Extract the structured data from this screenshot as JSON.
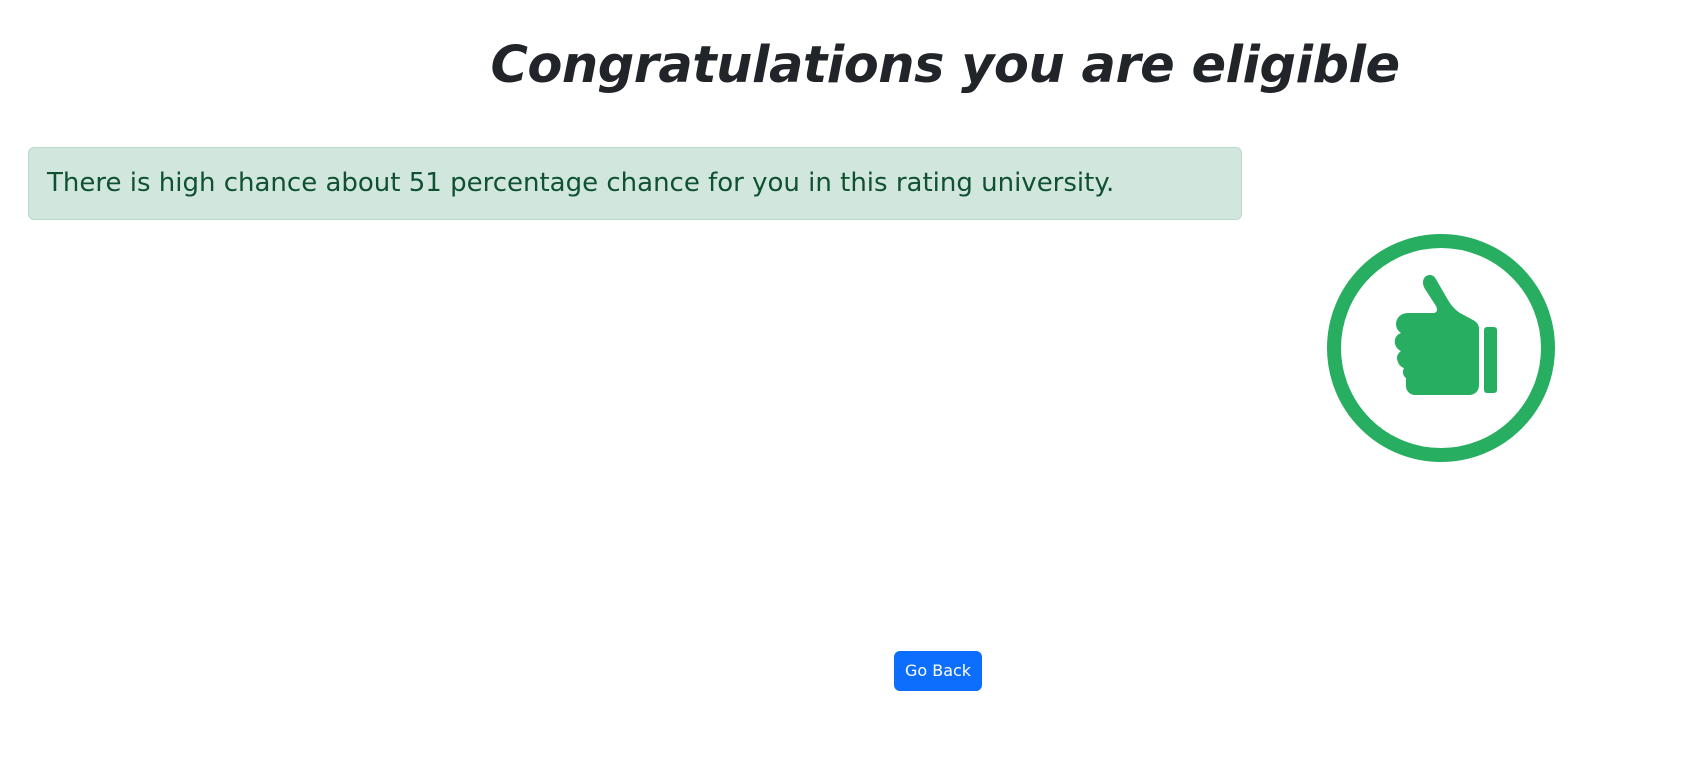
{
  "page": {
    "title": "Congratulations you are eligible"
  },
  "result": {
    "message": "There is high chance about 51 percentage chance for you in this rating university."
  },
  "badge": {
    "icon": "thumbs-up-icon",
    "color": "#27ae60"
  },
  "actions": {
    "go_back_label": "Go Back"
  },
  "theme": {
    "alert_background": "#d1e7dd",
    "alert_text": "#0f5132",
    "button_primary": "#0d6efd"
  }
}
